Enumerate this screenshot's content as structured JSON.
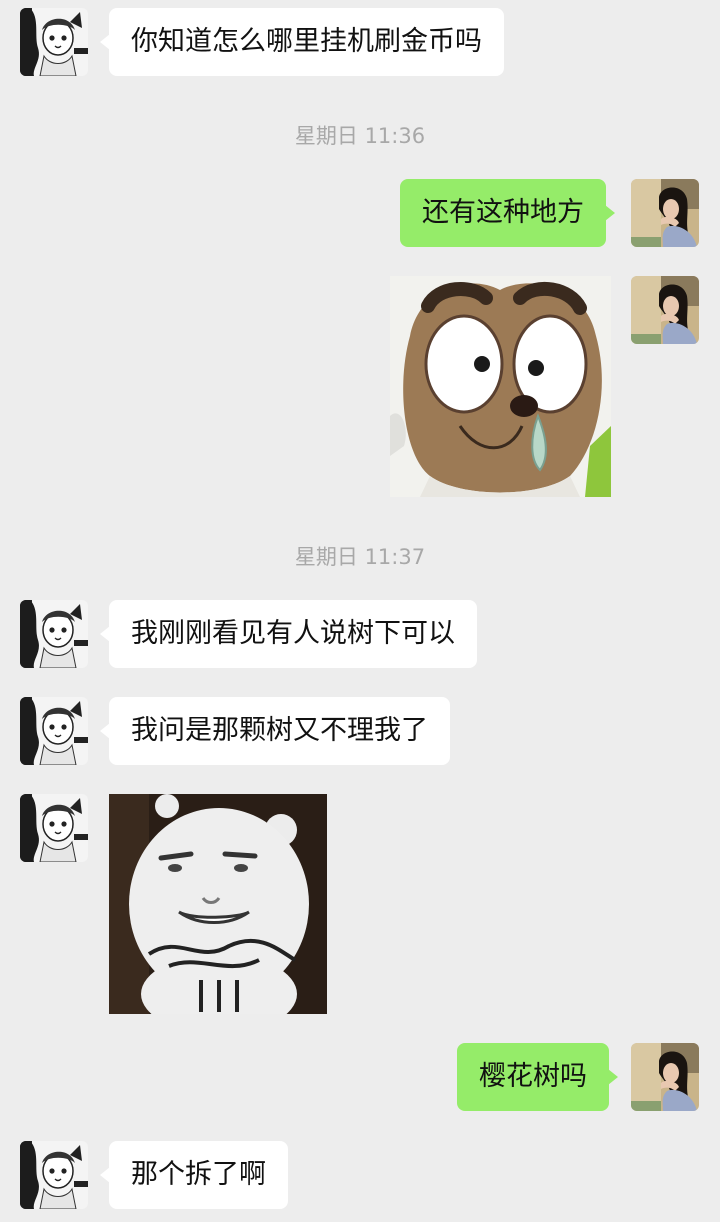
{
  "chat": {
    "messages": [
      {
        "sender": "other",
        "type": "text",
        "text": "你知道怎么哪里挂机刷金币吗"
      },
      {
        "type": "timestamp",
        "text": "星期日 11:36"
      },
      {
        "sender": "self",
        "type": "text",
        "text": "还有这种地方"
      },
      {
        "sender": "self",
        "type": "sticker",
        "sticker": "cartoon-bear-sticker"
      },
      {
        "type": "timestamp",
        "text": "星期日 11:37"
      },
      {
        "sender": "other",
        "type": "text",
        "text": "我刚刚看见有人说树下可以"
      },
      {
        "sender": "other",
        "type": "text",
        "text": "我问是那颗树又不理我了"
      },
      {
        "sender": "other",
        "type": "sticker",
        "sticker": "panda-meme-sticker"
      },
      {
        "sender": "self",
        "type": "text",
        "text": "樱花树吗"
      },
      {
        "sender": "other",
        "type": "text",
        "text": "那个拆了啊"
      }
    ]
  },
  "colors": {
    "background": "#ededed",
    "self_bubble": "#95ec69",
    "other_bubble": "#ffffff",
    "timestamp_text": "#a8a8a8"
  }
}
